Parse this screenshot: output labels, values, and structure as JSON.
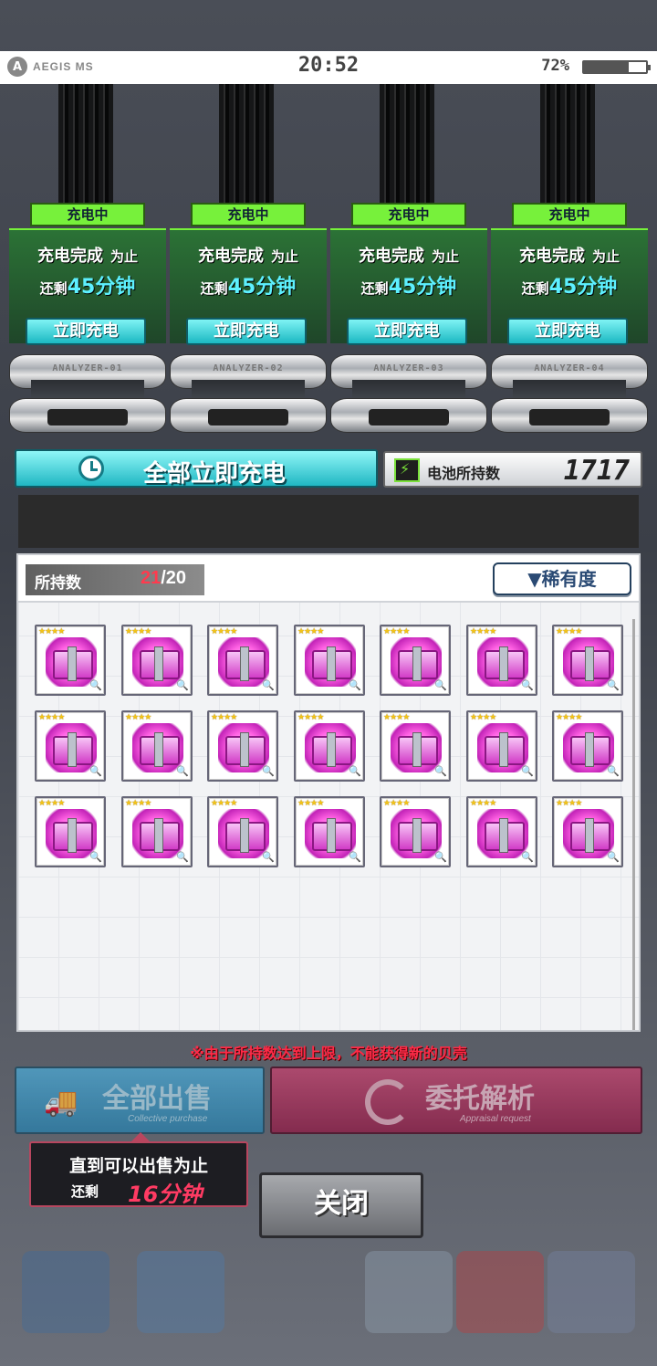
{
  "status_bar": {
    "logo_text": "AEGIS MS",
    "time": "20:52",
    "battery_percent": "72%",
    "battery_level": 0.72
  },
  "analyzers": [
    {
      "status": "充电中",
      "line1": "充电完成",
      "line1_suffix": "为止",
      "remaining_prefix": "还剩",
      "remaining_value": "45分钟",
      "button": "立即充电",
      "device_tag": "ANALYZER-01"
    },
    {
      "status": "充电中",
      "line1": "充电完成",
      "line1_suffix": "为止",
      "remaining_prefix": "还剩",
      "remaining_value": "45分钟",
      "button": "立即充电",
      "device_tag": "ANALYZER-02"
    },
    {
      "status": "充电中",
      "line1": "充电完成",
      "line1_suffix": "为止",
      "remaining_prefix": "还剩",
      "remaining_value": "45分钟",
      "button": "立即充电",
      "device_tag": "ANALYZER-03"
    },
    {
      "status": "充电中",
      "line1": "充电完成",
      "line1_suffix": "为止",
      "remaining_prefix": "还剩",
      "remaining_value": "45分钟",
      "button": "立即充电",
      "device_tag": "ANALYZER-04"
    }
  ],
  "charge_all": {
    "label": "全部立即充电",
    "icon": "clock-icon"
  },
  "battery_count": {
    "label": "电池所持数",
    "value": "1717",
    "icon": "battery-icon"
  },
  "inventory": {
    "count_label": "所持数",
    "count_current": "21",
    "count_max": "/20",
    "sort_button": "▼稀有度",
    "item_stars": "★★★★",
    "items": [
      {
        "name": "shell"
      },
      {
        "name": "shell"
      },
      {
        "name": "shell"
      },
      {
        "name": "shell"
      },
      {
        "name": "shell"
      },
      {
        "name": "shell"
      },
      {
        "name": "shell"
      },
      {
        "name": "shell"
      },
      {
        "name": "shell"
      },
      {
        "name": "shell"
      },
      {
        "name": "shell"
      },
      {
        "name": "shell"
      },
      {
        "name": "shell"
      },
      {
        "name": "shell"
      },
      {
        "name": "shell"
      },
      {
        "name": "shell"
      },
      {
        "name": "shell"
      },
      {
        "name": "shell"
      },
      {
        "name": "shell"
      },
      {
        "name": "shell"
      },
      {
        "name": "shell"
      }
    ]
  },
  "warning": "※由于所持数达到上限，不能获得新的贝壳",
  "sell_button": {
    "label": "全部出售",
    "sub": "Collective purchase",
    "icon": "truck-icon"
  },
  "analyze_button": {
    "label": "委托解析",
    "sub": "Appraisal request",
    "icon": "ring-icon"
  },
  "tooltip": {
    "line1": "直到可以出售为止",
    "prefix": "还剩",
    "value": "16分钟"
  },
  "close_button": "关闭",
  "colors": {
    "accent_green": "#77f13b",
    "accent_cyan": "#20b7c3",
    "warning_red": "#ff2a47"
  }
}
